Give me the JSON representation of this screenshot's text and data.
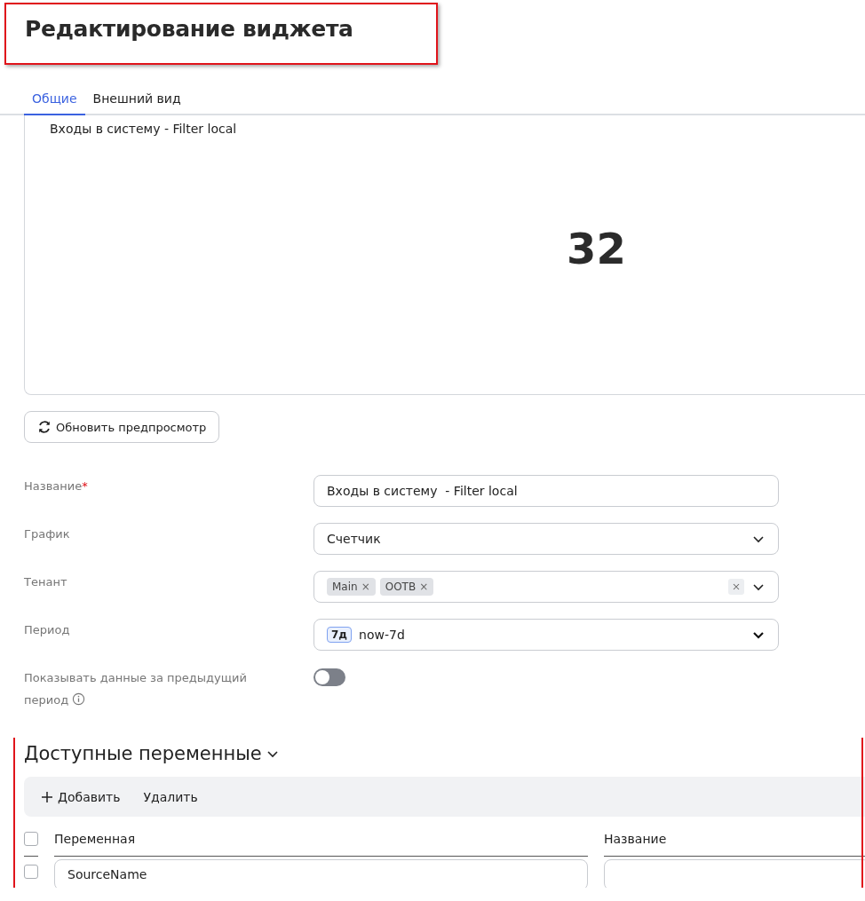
{
  "title": {
    "text": "Редактирование виджета",
    "highlighted": true
  },
  "tabs": [
    {
      "label": "Общие",
      "selected": true
    },
    {
      "label": "Внешний вид",
      "selected": false
    }
  ],
  "preview": {
    "title": "Входы в систему - Filter local",
    "value": "32"
  },
  "refresh_button": "Обновить предпросмотр",
  "form": [
    {
      "kind": "text",
      "label": "Название",
      "required_mark": "*",
      "value": "Входы в систему  - Filter local"
    },
    {
      "kind": "select",
      "label": "График",
      "value": "Счетчик"
    },
    {
      "kind": "tags",
      "label": "Тенант",
      "tags": [
        "Main",
        "OOTB"
      ],
      "tag_remove": "×"
    },
    {
      "kind": "period",
      "label": "Период",
      "badge": "7д",
      "value": "now-7d"
    },
    {
      "kind": "toggle",
      "label": "Показывать данные за предыдущий период",
      "on": false
    }
  ],
  "variables": {
    "title": "Доступные переменные",
    "highlighted": true,
    "expanded": true,
    "toolbar": [
      "Добавить",
      "Удалить"
    ],
    "select_all_checked": false,
    "columns": [
      "Переменная",
      "Название"
    ],
    "rows": [
      {
        "checked": false,
        "variable": "SourceName"
      }
    ]
  }
}
